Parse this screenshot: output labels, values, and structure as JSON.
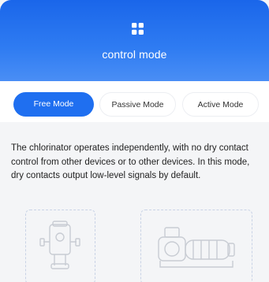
{
  "header": {
    "title": "control mode",
    "icon": "grid-icon"
  },
  "modes": {
    "free": "Free Mode",
    "passive": "Passive Mode",
    "active": "Active Mode",
    "selected": "Free Mode"
  },
  "description": "The chlorinator operates independently, with no dry contact control from other devices or to other devices. In this mode, dry contacts output low-level signals by default.",
  "illustrations": {
    "left": "chlorinator-device-illustration",
    "right": "pump-device-illustration"
  },
  "colors": {
    "accent": "#1f6ff0",
    "header_top": "#1a66ea",
    "header_bottom": "#4a8ef5",
    "background": "#f4f5f7"
  }
}
